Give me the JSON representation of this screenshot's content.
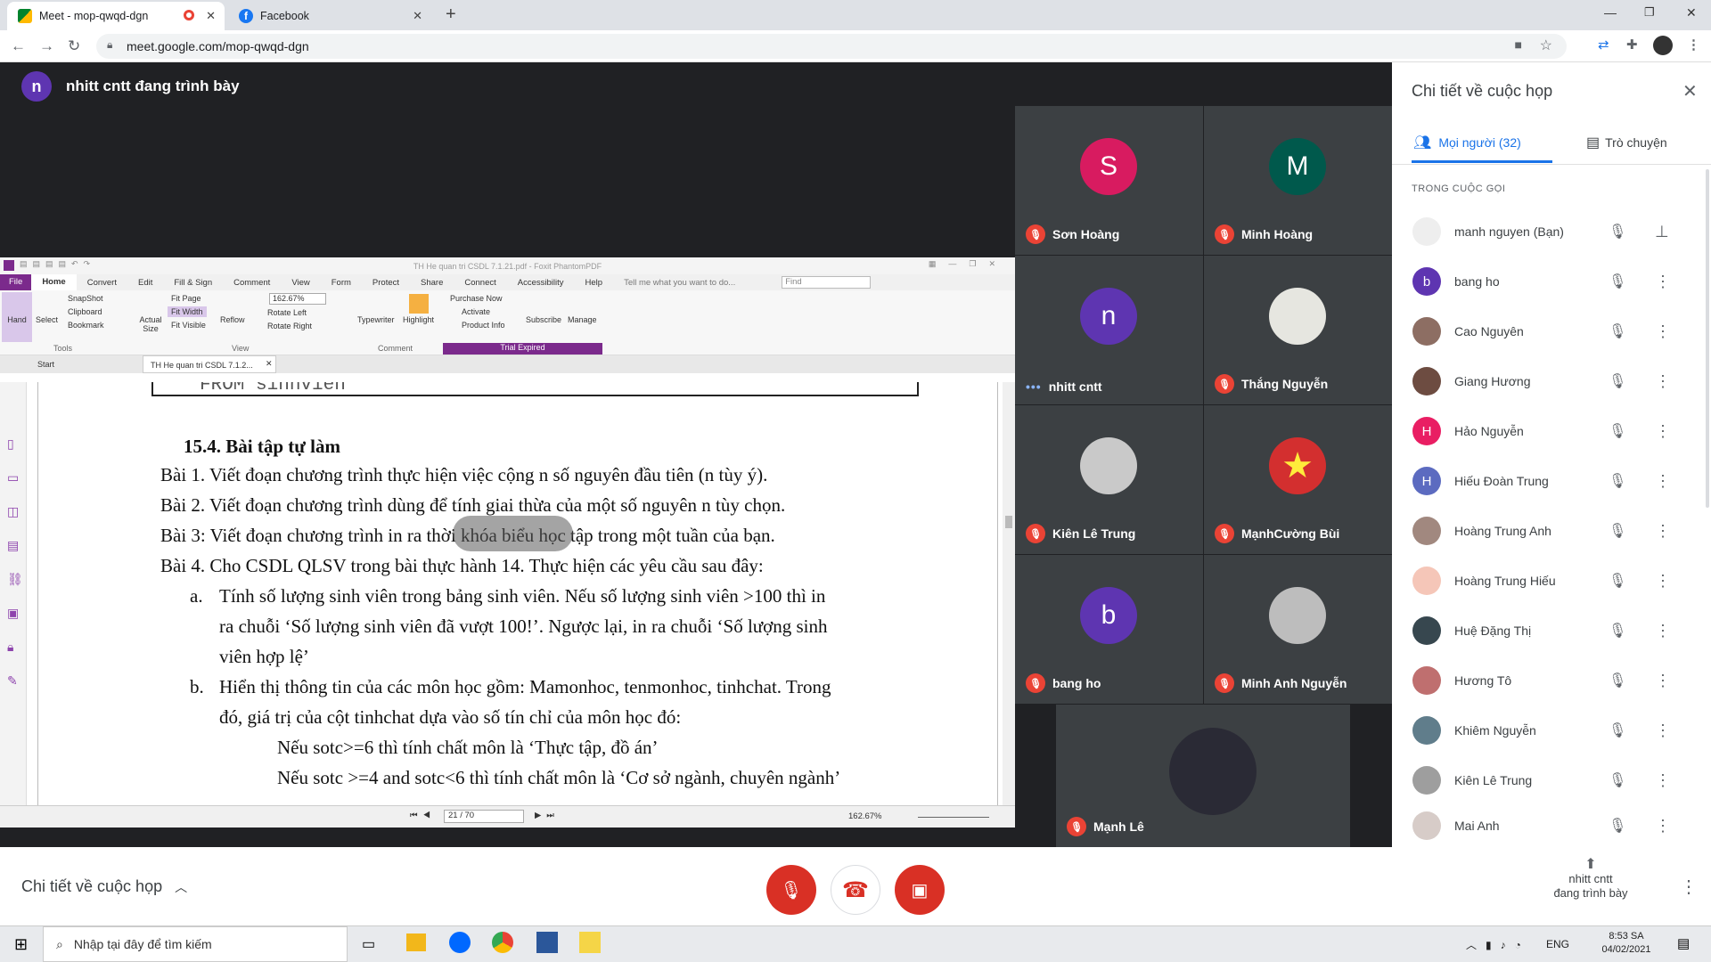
{
  "browser": {
    "tabs": [
      {
        "title": "Meet - mop-qwqd-dgn"
      },
      {
        "title": "Facebook"
      }
    ],
    "url": "meet.google.com/mop-qwqd-dgn"
  },
  "meet": {
    "presenter_initial": "n",
    "presenter_banner": "nhitt cntt đang trình bày",
    "tiles": [
      {
        "name": "Sơn Hoàng",
        "initial": "S",
        "color": "#d81b60"
      },
      {
        "name": "Minh Hoàng",
        "initial": "M",
        "color": "#00594c"
      },
      {
        "name": "nhitt cntt",
        "initial": "n",
        "color": "#5e35b1"
      },
      {
        "name": "Thắng Nguyễn",
        "initial": "",
        "color": "#e6e6e0"
      },
      {
        "name": "Kiên Lê Trung",
        "initial": "",
        "color": "#c9c9c9"
      },
      {
        "name": "MạnhCường Bùi",
        "initial": "★",
        "color": "#d32f2f"
      },
      {
        "name": "bang ho",
        "initial": "b",
        "color": "#5e35b1"
      },
      {
        "name": "Minh Anh Nguyễn",
        "initial": "",
        "color": "#bdbdbd"
      },
      {
        "name": "Mạnh Lê",
        "initial": "",
        "color": "#2a2a35"
      }
    ],
    "bottom": {
      "details_label": "Chi tiết về cuộc họp",
      "present_line1": "nhitt cntt",
      "present_line2": "đang trình bày"
    }
  },
  "pdf": {
    "app_title": "TH He quan tri CSDL 7.1.21.pdf - Foxit PhantomPDF",
    "ribbon_tabs": [
      "File",
      "Home",
      "Convert",
      "Edit",
      "Fill & Sign",
      "Comment",
      "View",
      "Form",
      "Protect",
      "Share",
      "Connect",
      "Accessibility",
      "Help"
    ],
    "tell_me": "Tell me what you want to do...",
    "find_placeholder": "Find",
    "tools": {
      "hand": "Hand",
      "select": "Select",
      "snapshot": "SnapShot",
      "clipboard": "Clipboard",
      "bookmark": "Bookmark",
      "group_tools": "Tools",
      "actual_size": "Actual Size",
      "fit_page": "Fit Page",
      "fit_width": "Fit Width",
      "fit_visible": "Fit Visible",
      "reflow": "Reflow",
      "zoom": "162.67%",
      "rotate_left": "Rotate Left",
      "rotate_right": "Rotate Right",
      "group_view": "View",
      "typewriter": "Typewriter",
      "highlight": "Highlight",
      "group_comment": "Comment",
      "purchase": "Purchase Now",
      "activate": "Activate",
      "product_info": "Product Info",
      "subscribe": "Subscribe",
      "manage": "Manage",
      "trial": "Trial Expired"
    },
    "doc_tabs": [
      "Start",
      "TH He quan tri CSDL 7.1.2..."
    ],
    "page_lines": [
      "FROM  sinhvien",
      "15.4. Bài tập tự làm",
      "Bài 1. Viết đoạn chương trình thực hiện việc cộng n số nguyên đầu tiên (n tùy ý).",
      "Bài 2. Viết đoạn chương trình dùng để tính giai thừa của một số nguyên n tùy chọn.",
      "Bài 3: Viết đoạn chương trình in ra thời khóa biểu học tập trong một tuần của bạn.",
      "Bài 4. Cho CSDL QLSV trong bài thực hành 14. Thực hiện các yêu cầu sau đây:",
      "a.",
      "Tính số lượng sinh viên trong bảng sinh viên. Nếu số lượng sinh viên >100 thì in",
      "ra chuỗi ‘Số lượng sinh viên đã vượt 100!’. Ngược lại, in ra chuỗi ‘Số lượng sinh",
      "viên hợp lệ’",
      "b.",
      "Hiển thị thông tin của các môn học gồm: Mamonhoc, tenmonhoc, tinhchat. Trong",
      "đó, giá trị của cột tinhchat dựa vào số tín chỉ của môn học đó:",
      "Nếu sotc>=6 thì tính chất môn là ‘Thực tập, đồ án’",
      "Nếu sotc >=4 and sotc<6 thì tính chất môn là ‘Cơ sở ngành, chuyên ngành’"
    ],
    "status": {
      "page": "21 / 70",
      "zoom": "162.67%"
    }
  },
  "panel": {
    "title": "Chi tiết về cuộc họp",
    "tab_people": "Mọi người (32)",
    "tab_chat": "Trò chuyện",
    "section": "TRONG CUỘC GỌI",
    "people": [
      {
        "name": "manh nguyen (Bạn)",
        "initial": "",
        "color": "#ddd"
      },
      {
        "name": "bang ho",
        "initial": "b",
        "color": "#5e35b1"
      },
      {
        "name": "Cao Nguyên",
        "initial": "",
        "color": "#8d6e63"
      },
      {
        "name": "Giang Hương",
        "initial": "",
        "color": "#6d4c41"
      },
      {
        "name": "Hảo Nguyễn",
        "initial": "H",
        "color": "#e91e63"
      },
      {
        "name": "Hiếu Đoàn Trung",
        "initial": "H",
        "color": "#5c6bc0"
      },
      {
        "name": "Hoàng Trung Anh",
        "initial": "",
        "color": "#a1887f"
      },
      {
        "name": "Hoàng Trung Hiếu",
        "initial": "",
        "color": "#f5c6b8"
      },
      {
        "name": "Huệ Đặng Thị",
        "initial": "",
        "color": "#37474f"
      },
      {
        "name": "Hương Tô",
        "initial": "",
        "color": "#bf6f6f"
      },
      {
        "name": "Khiêm Nguyễn",
        "initial": "",
        "color": "#607d8b"
      },
      {
        "name": "Kiên Lê Trung",
        "initial": "",
        "color": "#9e9e9e"
      },
      {
        "name": "Mai Anh",
        "initial": "",
        "color": "#d7ccc8"
      }
    ]
  },
  "taskbar": {
    "search_placeholder": "Nhập tại đây để tìm kiếm",
    "lang": "ENG",
    "time": "8:53 SA",
    "date": "04/02/2021"
  }
}
